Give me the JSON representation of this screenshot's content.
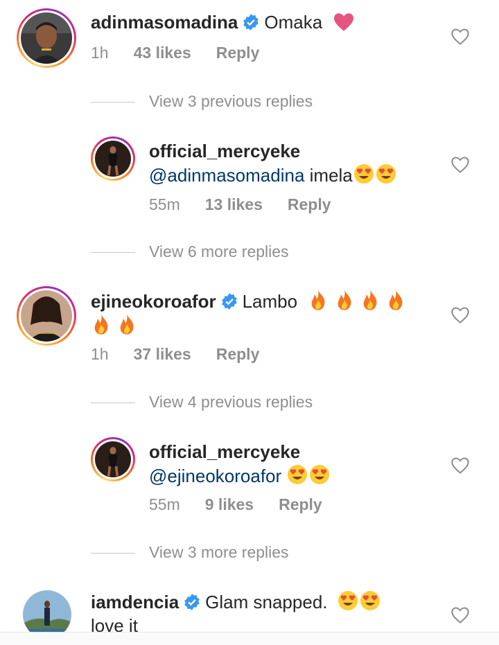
{
  "comments": [
    {
      "username": "adinmasomadina",
      "text": "Omaka",
      "time": "1h",
      "likes": "43 likes",
      "reply": "Reply",
      "view_replies": "View 3 previous replies"
    },
    {
      "username": "official_mercyeke",
      "mention": "@adinmasomadina",
      "text": "imela",
      "time": "55m",
      "likes": "13 likes",
      "reply": "Reply",
      "view_replies": "View 6 more replies"
    },
    {
      "username": "ejineokoroafor",
      "text": "Lambo",
      "time": "1h",
      "likes": "37 likes",
      "reply": "Reply",
      "view_replies": "View 4 previous replies"
    },
    {
      "username": "official_mercyeke",
      "mention": "@ejineokoroafor",
      "text": "",
      "time": "55m",
      "likes": "9 likes",
      "reply": "Reply",
      "view_replies": "View 3 more replies"
    },
    {
      "username": "iamdencia",
      "text": "Glam snapped.",
      "text_line2": "love it"
    }
  ],
  "colors": {
    "verified": "#3897f0",
    "mention": "#00376b",
    "meta": "#8e8e8e",
    "heart_pink": "#e75480"
  }
}
